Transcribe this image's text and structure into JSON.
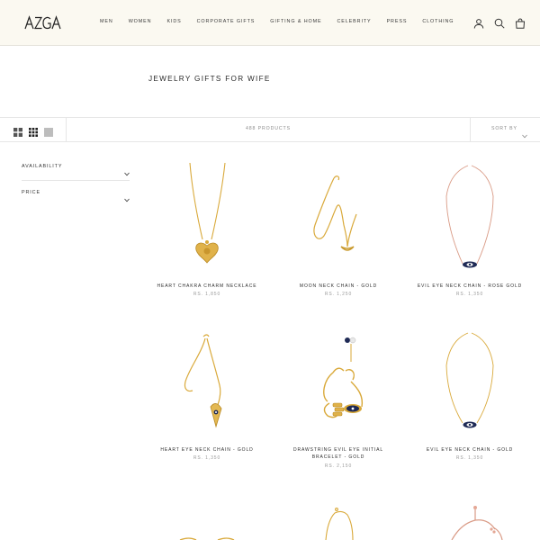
{
  "header": {
    "logo_text": "AZGA",
    "nav": [
      "MEN",
      "WOMEN",
      "KIDS",
      "CORPORATE GIFTS",
      "GIFTING & HOME",
      "CELEBRITY",
      "PRESS",
      "CLOTHING"
    ],
    "icons": [
      "account-icon",
      "search-icon",
      "cart-icon"
    ]
  },
  "page": {
    "title": "JEWELRY GIFTS FOR WIFE"
  },
  "toolbar": {
    "product_count": "488 PRODUCTS",
    "sort_label": "SORT BY",
    "view_icons": [
      "grid-2-icon",
      "grid-3-icon",
      "grid-1-icon"
    ]
  },
  "filters": [
    {
      "label": "AVAILABILITY"
    },
    {
      "label": "PRICE"
    }
  ],
  "products": [
    {
      "name": "HEART CHAKRA CHARM NECKLACE",
      "name2": "",
      "price": "RS. 1,850",
      "image": "heart-chakra-pendant-gold"
    },
    {
      "name": "MOON NECK CHAIN - GOLD",
      "name2": "",
      "price": "RS. 1,250",
      "image": "moon-chain-gold"
    },
    {
      "name": "EVIL EYE NECK CHAIN - ROSE GOLD",
      "name2": "",
      "price": "RS. 1,350",
      "image": "evil-eye-chain-rose-gold"
    },
    {
      "name": "HEART EYE NECK CHAIN - GOLD",
      "name2": "",
      "price": "RS. 1,350",
      "image": "heart-eye-chain-gold"
    },
    {
      "name": "DRAWSTRING EVIL EYE INITIAL",
      "name2": "BRACELET - GOLD",
      "price": "RS. 2,150",
      "image": "drawstring-evil-eye-bracelet"
    },
    {
      "name": "EVIL EYE NECK CHAIN - GOLD",
      "name2": "",
      "price": "RS. 1,350",
      "image": "evil-eye-chain-gold"
    }
  ],
  "colors": {
    "header_bg": "#fbf9f1",
    "gold": "#d9a93a",
    "rose_gold": "#d99a85",
    "evil_eye_navy": "#1f2a55"
  }
}
